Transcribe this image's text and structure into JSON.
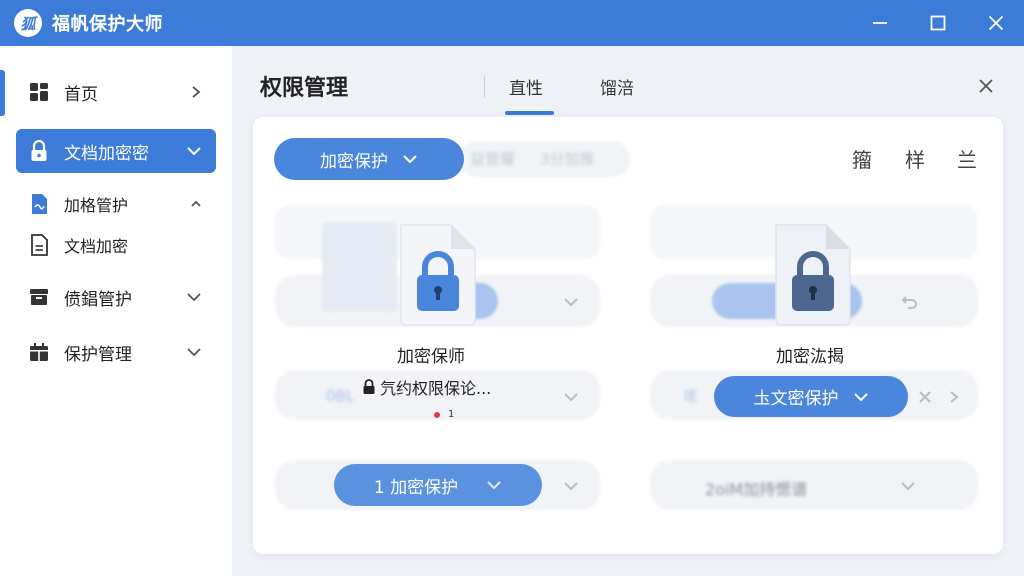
{
  "window": {
    "title": "福帆保护大师",
    "logo_text": "狐",
    "controls": [
      "minimize-icon",
      "maximize-icon",
      "close-icon"
    ],
    "accent_color": "#3d7bd9"
  },
  "sidebar": {
    "items": [
      {
        "label": "首页",
        "icon": "grid-icon",
        "state": "collapsed"
      },
      {
        "label": "文档加密密",
        "icon": "lock-icon",
        "state": "active-expanded"
      },
      {
        "label": "加格管护",
        "icon": "file-signature-icon",
        "state": "sub-expanded"
      },
      {
        "label": "文档加密",
        "icon": "document-icon",
        "state": "sub"
      },
      {
        "label": "偾錩管护",
        "icon": "archive-icon",
        "state": "collapsed"
      },
      {
        "label": "保护管理",
        "icon": "calendar-icon",
        "state": "collapsed"
      }
    ]
  },
  "header": {
    "title": "权限管理",
    "tabs": [
      {
        "label": "直性",
        "active": true
      },
      {
        "label": "馏涪",
        "active": false
      }
    ]
  },
  "panel": {
    "main_button": "加密保护",
    "tools": [
      "籀",
      "样",
      "兰"
    ],
    "blur_text_top": [
      "益管羅",
      "3分加推"
    ],
    "cards": [
      {
        "label": "加密保师",
        "icon": "lock-file-icon"
      },
      {
        "label": "加密汯揭",
        "icon": "lock-file-icon"
      }
    ],
    "lock_line": "氕约权限保论...",
    "count_badge": "1",
    "right_button": "圡文密保护",
    "bottom_button": "1 加密保护",
    "bottom_right_text": "2oiM加持愢谱",
    "blur_text_mid": "0BL",
    "blur_text_mid_right": "IE"
  }
}
